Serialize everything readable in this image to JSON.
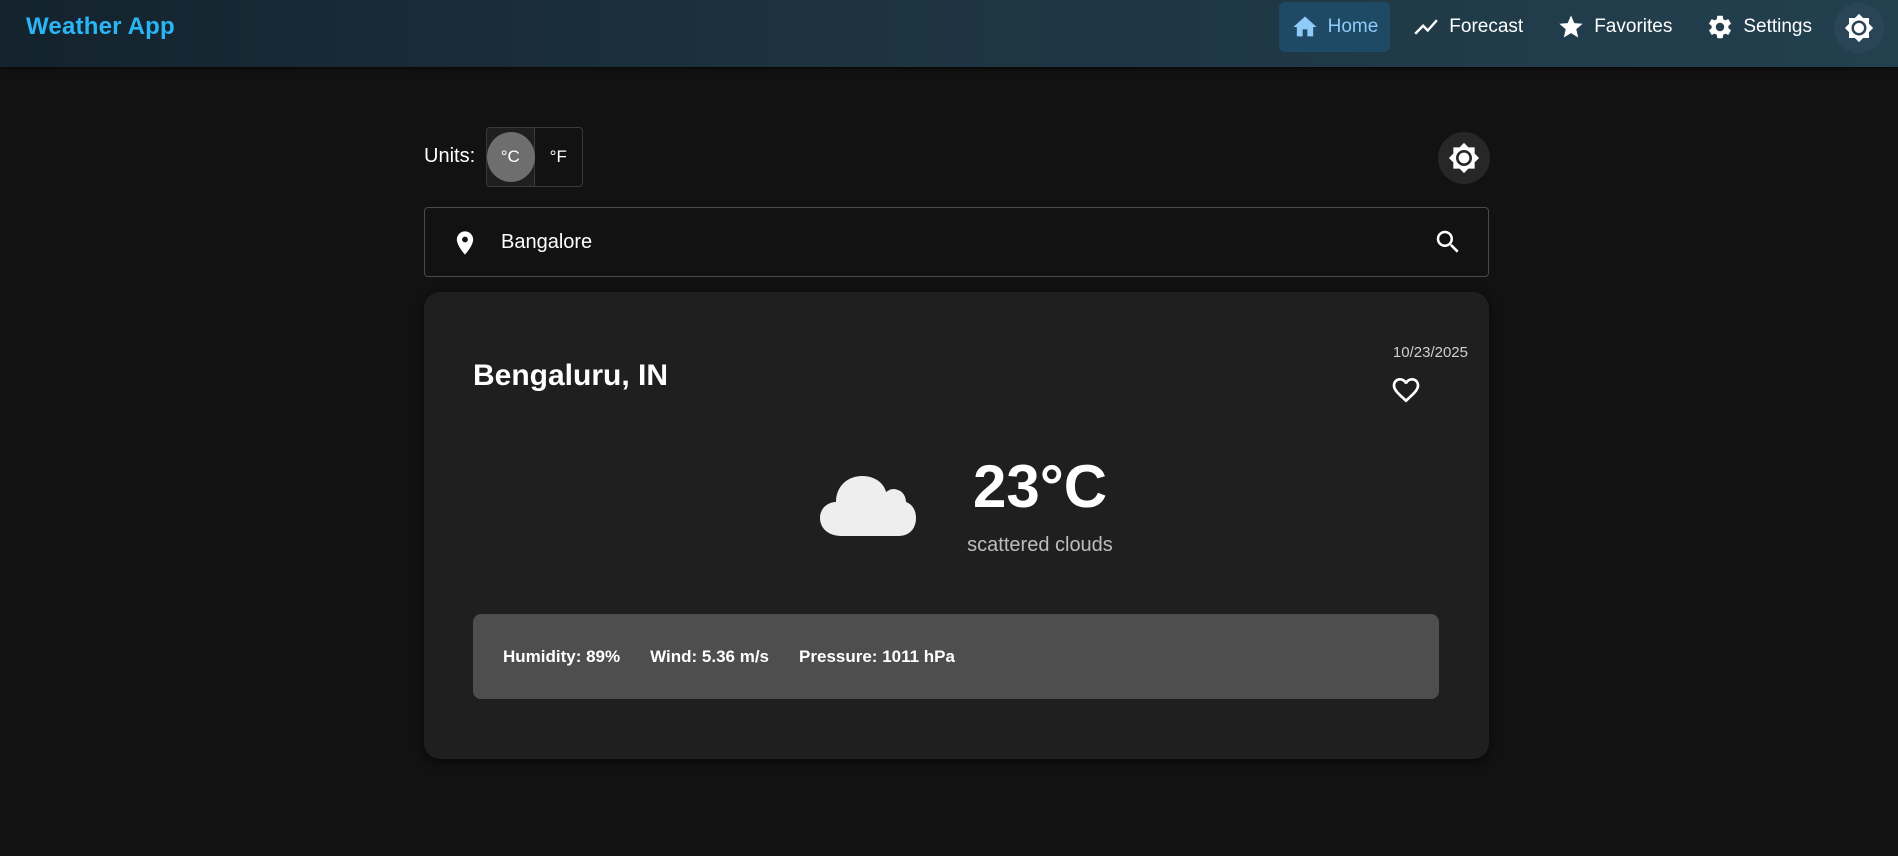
{
  "app": {
    "title": "Weather App"
  },
  "nav": {
    "items": [
      {
        "label": "Home",
        "icon": "home-icon",
        "active": true
      },
      {
        "label": "Forecast",
        "icon": "trending-icon",
        "active": false
      },
      {
        "label": "Favorites",
        "icon": "star-icon",
        "active": false
      },
      {
        "label": "Settings",
        "icon": "gear-icon",
        "active": false
      }
    ],
    "theme_icon": "brightness-icon"
  },
  "units": {
    "label": "Units:",
    "options": [
      "°C",
      "°F"
    ],
    "selected": "°C"
  },
  "search": {
    "value": "Bangalore",
    "location_icon": "location-pin-icon",
    "search_icon": "search-icon"
  },
  "weather": {
    "city": "Bengaluru, IN",
    "date": "10/23/2025",
    "temperature": "23°C",
    "description": "scattered clouds",
    "condition_icon": "cloud-icon",
    "favorite_icon": "heart-outline-icon",
    "stats": {
      "humidity": "Humidity: 89%",
      "wind": "Wind: 5.36 m/s",
      "pressure": "Pressure: 1011 hPa"
    }
  },
  "colors": {
    "brand": "#29b6f6",
    "active_nav_bg": "#1e4a66",
    "active_nav_text": "#90caf9",
    "background": "#121212",
    "card": "#1f1f1f",
    "stats_bar": "#4e4e4e"
  }
}
